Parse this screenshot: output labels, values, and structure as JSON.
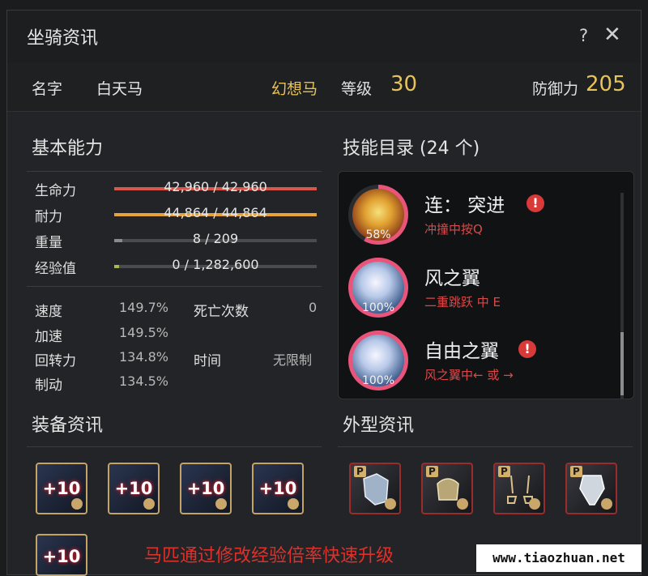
{
  "window": {
    "title": "坐骑资讯",
    "help_label": "?",
    "close_label": "✕"
  },
  "info": {
    "name_label": "名字",
    "name_value": "白天马",
    "type_value": "幻想马",
    "level_label": "等级",
    "level_value": "30",
    "defense_label": "防御力",
    "defense_value": "205"
  },
  "basic": {
    "title": "基本能力",
    "bars": [
      {
        "label": "生命力",
        "text": "42,960 / 42,960",
        "fill": 1.0,
        "color": "#d9574a"
      },
      {
        "label": "耐力",
        "text": "44,864 / 44,864",
        "fill": 1.0,
        "color": "#e8a23a"
      },
      {
        "label": "重量",
        "text": "8 / 209",
        "fill": 0.038,
        "color": "#8a8a8a"
      },
      {
        "label": "经验值",
        "text": "0 / 1,282,600",
        "fill": 0.0,
        "color": "#a8b84a"
      }
    ],
    "stats": {
      "speed_label": "速度",
      "speed_value": "149.7%",
      "accel_label": "加速",
      "accel_value": "149.5%",
      "turn_label": "回转力",
      "turn_value": "134.8%",
      "brake_label": "制动",
      "brake_value": "134.5%",
      "deaths_label": "死亡次数",
      "deaths_value": "0",
      "time_label": "时间",
      "time_value": "无限制"
    }
  },
  "skills": {
    "title": "技能目录 (24 个)",
    "items": [
      {
        "name": "连： 突进",
        "sub": "冲撞中按Q",
        "percent": "58%",
        "fill": 0.58,
        "warn": true
      },
      {
        "name": "风之翼",
        "sub": "二重跳跃 中 E",
        "percent": "100%",
        "fill": 1.0,
        "warn": false
      },
      {
        "name": "自由之翼",
        "sub": "风之翼中← 或 →",
        "percent": "100%",
        "fill": 1.0,
        "warn": true
      }
    ]
  },
  "equipment": {
    "title": "装备资讯",
    "slots": [
      {
        "enhance": "+10",
        "icon": "horse-armor-icon"
      },
      {
        "enhance": "+10",
        "icon": "saddle-icon"
      },
      {
        "enhance": "+10",
        "icon": "stirrups-icon"
      },
      {
        "enhance": "+10",
        "icon": "horseshoe-icon"
      },
      {
        "enhance": "+10",
        "icon": "horseshoe-icon"
      }
    ]
  },
  "appearance": {
    "title": "外型资讯",
    "badge": "P",
    "slots": [
      {
        "icon": "barding-icon"
      },
      {
        "icon": "saddle-icon"
      },
      {
        "icon": "stirrup-icon"
      },
      {
        "icon": "mask-icon"
      }
    ]
  },
  "caption": "马匹通过修改经验倍率快速升级",
  "watermark": "www.tiaozhuan.net"
}
